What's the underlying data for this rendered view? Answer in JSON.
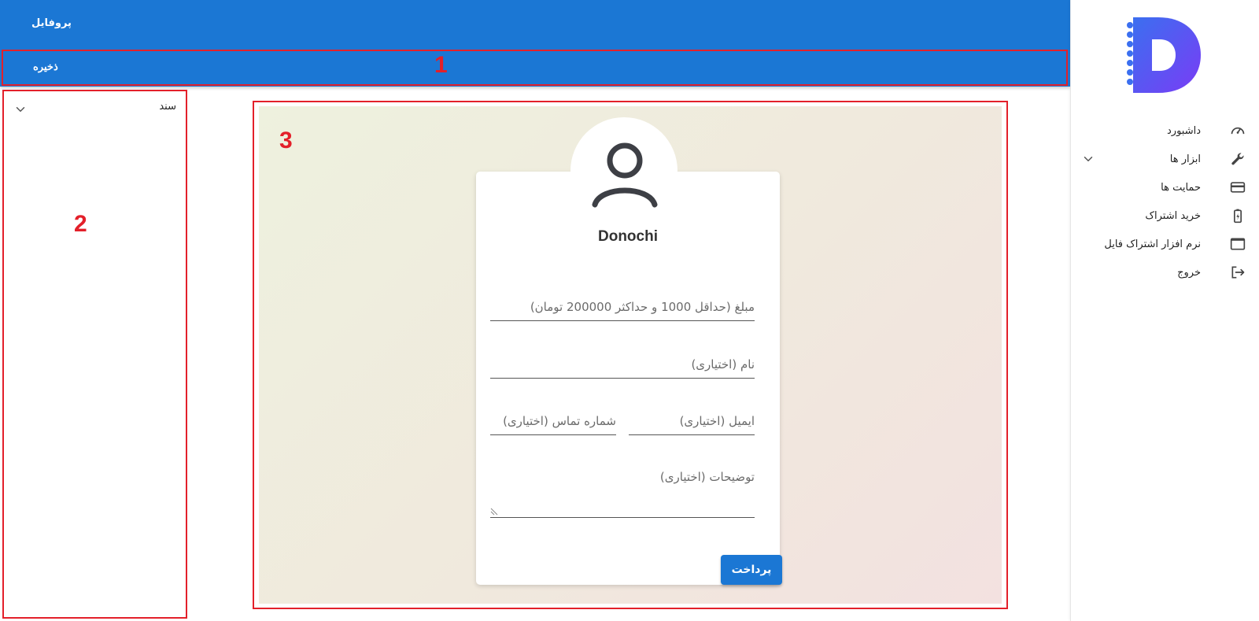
{
  "appbar": {
    "title": "پروفایل",
    "save_label": "ذخیره"
  },
  "sidebar": {
    "items": [
      {
        "label": "داشبورد",
        "icon": "speedometer-icon"
      },
      {
        "label": "ابزار ها",
        "icon": "wrench-icon",
        "has_chevron": true
      },
      {
        "label": "حمایت ها",
        "icon": "credit-card-icon"
      },
      {
        "label": "خرید اشتراک",
        "icon": "battery-charging-icon"
      },
      {
        "label": "نرم افزار اشتراک فایل",
        "icon": "window-icon"
      },
      {
        "label": "خروج",
        "icon": "logout-icon"
      }
    ]
  },
  "left_panel": {
    "title": "سند"
  },
  "profile": {
    "username": "Donochi",
    "fields": {
      "amount_placeholder": "مبلغ (حداقل 1000 و حداکثر 200000 تومان)",
      "name_placeholder": "نام (اختیاری)",
      "email_placeholder": "ایمیل (اختیاری)",
      "phone_placeholder": "شماره تماس (اختیاری)",
      "description_placeholder": "توضیحات (اختیاری)"
    },
    "pay_label": "پرداخت"
  },
  "annotations": {
    "a1": "1",
    "a2": "2",
    "a3": "3"
  },
  "colors": {
    "primary": "#1b77d4",
    "annotation": "#e3202a",
    "logo_gradient_start": "#3b6ff0",
    "logo_gradient_end": "#7a3cf5"
  }
}
